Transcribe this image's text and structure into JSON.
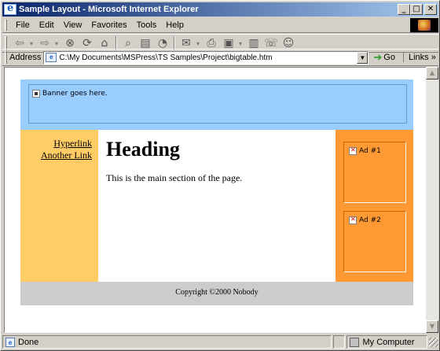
{
  "window": {
    "title": "Sample Layout - Microsoft Internet Explorer",
    "buttons": {
      "minimize": "_",
      "maximize": "□",
      "close": "✕"
    }
  },
  "menubar": {
    "items": [
      {
        "label": "File"
      },
      {
        "label": "Edit"
      },
      {
        "label": "View"
      },
      {
        "label": "Favorites"
      },
      {
        "label": "Tools"
      },
      {
        "label": "Help"
      }
    ]
  },
  "toolbar": {
    "icons": [
      "back-icon",
      "forward-icon",
      "stop-icon",
      "refresh-icon",
      "home-icon",
      "search-icon",
      "favorites-icon",
      "history-icon",
      "mail-icon",
      "print-icon",
      "edit-icon",
      "discuss-icon",
      "messenger-icon",
      "people-icon"
    ]
  },
  "addressbar": {
    "label": "Address",
    "url": "C:\\My Documents\\MSPress\\TS Samples\\Project\\bigtable.htm",
    "go_label": "Go",
    "links_label": "Links »"
  },
  "page": {
    "banner_text": "Banner goes here.",
    "left_links": [
      "Hyperlink",
      "Another Link"
    ],
    "heading": "Heading",
    "body_text": "This is the main section of the page.",
    "ads": [
      "Ad #1",
      "Ad #2"
    ],
    "footer": "Copyright ©2000 Nobody",
    "colors": {
      "banner": "#99ccff",
      "left_column": "#ffcc66",
      "right_column": "#ff9933",
      "footer": "#cccccc"
    }
  },
  "statusbar": {
    "status": "Done",
    "zone": "My Computer"
  }
}
